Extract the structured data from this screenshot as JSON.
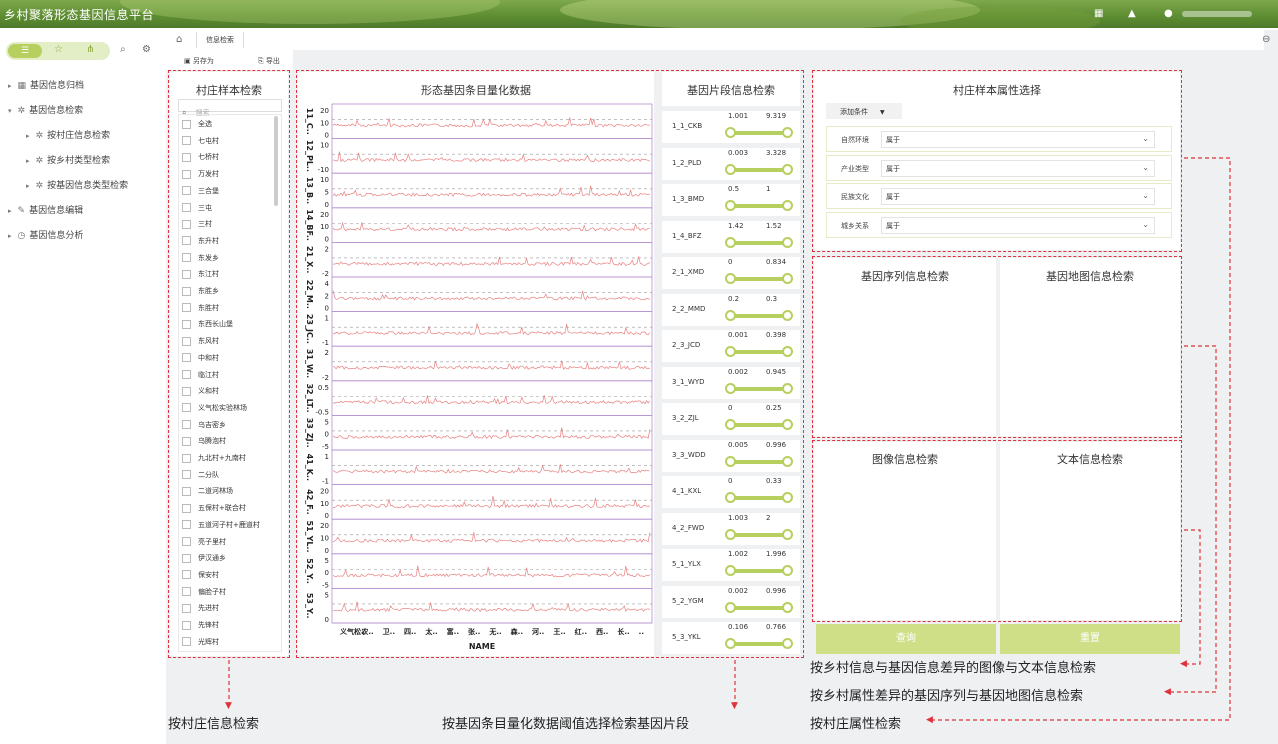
{
  "header": {
    "title": "乡村聚落形态基因信息平台"
  },
  "nav": {
    "items": [
      "基因信息归档",
      "基因信息检索",
      "按村庄信息检索",
      "按乡村类型检索",
      "按基因信息类型检索",
      "基因信息编辑",
      "基因信息分析"
    ]
  },
  "tabs": {
    "current": "信息检索"
  },
  "toolbar": {
    "save_as": "另存为",
    "export": "导出"
  },
  "village_panel": {
    "title": "村庄样本检索",
    "search_placeholder": "搜索",
    "items": [
      "全选",
      "七屯村",
      "七桥村",
      "万发村",
      "三合堡",
      "三屯",
      "三村",
      "东升村",
      "东发乡",
      "东江村",
      "东胜乡",
      "东胜村",
      "东西长山堡",
      "东风村",
      "中和村",
      "临江村",
      "义和村",
      "义气松实验林场",
      "乌吉密乡",
      "乌腾泡村",
      "九北村+九南村",
      "二分队",
      "二道河林场",
      "五保村+联合村",
      "五道河子村+鹿道村",
      "亮子里村",
      "伊汉通乡",
      "保安村",
      "偏脸子村",
      "先进村",
      "先锋村",
      "光辉村"
    ]
  },
  "chart_panel": {
    "title": "形态基因条目量化数据"
  },
  "chart_data": {
    "type": "line",
    "xlabel": "NAME",
    "x_ticks": [
      "义气松..",
      "农..",
      "卫..",
      "四..",
      "太..",
      "富..",
      "张..",
      "无..",
      "森..",
      "河..",
      "王..",
      "红..",
      "西..",
      "长..",
      ".."
    ],
    "series": [
      {
        "name": "11_C..",
        "ticks": [
          "20",
          "10",
          "0"
        ]
      },
      {
        "name": "12_PL..",
        "ticks": [
          "10",
          "-10"
        ]
      },
      {
        "name": "13_B..",
        "ticks": [
          "10",
          "5",
          "0"
        ]
      },
      {
        "name": "14_BF..",
        "ticks": [
          "20",
          "10",
          "0"
        ]
      },
      {
        "name": "21_X..",
        "ticks": [
          "2",
          "-2"
        ]
      },
      {
        "name": "22_M..",
        "ticks": [
          "4",
          "2",
          "0"
        ]
      },
      {
        "name": "23_JC..",
        "ticks": [
          "1",
          "-1"
        ]
      },
      {
        "name": "31_W..",
        "ticks": [
          "2",
          "-2"
        ]
      },
      {
        "name": "32_LT..",
        "ticks": [
          "0.5",
          "-0.5"
        ]
      },
      {
        "name": "33_ZJ..",
        "ticks": [
          "5",
          "0",
          "-5"
        ]
      },
      {
        "name": "41_K..",
        "ticks": [
          "1",
          "-1"
        ]
      },
      {
        "name": "42_F..",
        "ticks": [
          "20",
          "10",
          "0"
        ]
      },
      {
        "name": "51_YL..",
        "ticks": [
          "20",
          "10",
          "0"
        ]
      },
      {
        "name": "52_Y..",
        "ticks": [
          "5",
          "0",
          "-5"
        ]
      },
      {
        "name": "53_Y..",
        "ticks": [
          "5",
          "0"
        ]
      }
    ],
    "line_color": "#e88080",
    "grid": "dashed-midline"
  },
  "gene_panel": {
    "title": "基因片段信息检索",
    "rows": [
      {
        "label": "1_1_CKB",
        "min": "1.001",
        "max": "9.319"
      },
      {
        "label": "1_2_PLD",
        "min": "0.003",
        "max": "3.328"
      },
      {
        "label": "1_3_BMD",
        "min": "0.5",
        "max": "1"
      },
      {
        "label": "1_4_BFZ",
        "min": "1.42",
        "max": "1.52"
      },
      {
        "label": "2_1_XMD",
        "min": "0",
        "max": "0.834"
      },
      {
        "label": "2_2_MMD",
        "min": "0.2",
        "max": "0.3"
      },
      {
        "label": "2_3_JCD",
        "min": "0.001",
        "max": "0.398"
      },
      {
        "label": "3_1_WYD",
        "min": "0.002",
        "max": "0.945"
      },
      {
        "label": "3_2_ZJL",
        "min": "0",
        "max": "0.25"
      },
      {
        "label": "3_3_WDD",
        "min": "0.005",
        "max": "0.996"
      },
      {
        "label": "4_1_KXL",
        "min": "0",
        "max": "0.33"
      },
      {
        "label": "4_2_FWD",
        "min": "1.003",
        "max": "2"
      },
      {
        "label": "5_1_YLX",
        "min": "1.002",
        "max": "1.996"
      },
      {
        "label": "5_2_YGM",
        "min": "0.002",
        "max": "0.996"
      },
      {
        "label": "5_3_YKL",
        "min": "0.106",
        "max": "0.766"
      }
    ]
  },
  "attr_panel": {
    "title": "村庄样本属性选择",
    "add_label": "添加条件",
    "rows": [
      {
        "label": "自然环境",
        "value": "属于"
      },
      {
        "label": "产业类型",
        "value": "属于"
      },
      {
        "label": "民族文化",
        "value": "属于"
      },
      {
        "label": "城乡关系",
        "value": "属于"
      }
    ]
  },
  "search_panels": {
    "seq": "基因序列信息检索",
    "map": "基因地图信息检索",
    "img": "图像信息检索",
    "text": "文本信息检索"
  },
  "buttons": {
    "query": "查询",
    "reset": "重置"
  },
  "annotations": {
    "a1": "按乡村信息与基因信息差异的图像与文本信息检索",
    "a2": "按乡村属性差异的基因序列与基因地图信息检索",
    "a3": "按村庄属性检索",
    "a4": "按村庄信息检索",
    "a5": "按基因条目量化数据阈值选择检索基因片段"
  },
  "colors": {
    "accent": "#b6cf5e",
    "annotation": "#e0323c",
    "header": "#5f8f33"
  }
}
